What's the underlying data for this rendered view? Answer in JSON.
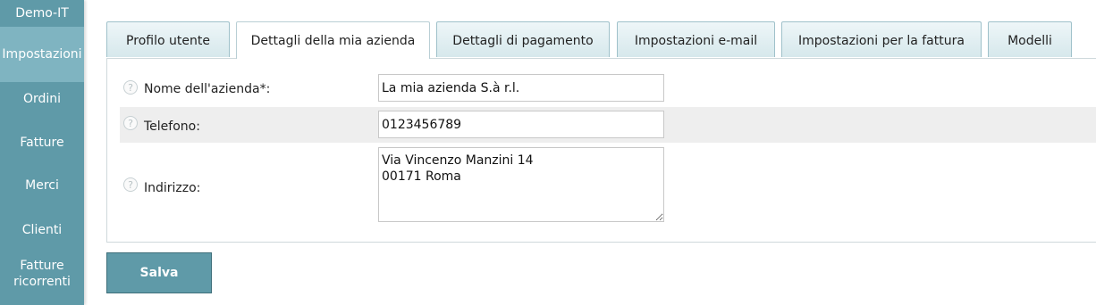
{
  "sidebar": {
    "brand": "Demo-IT",
    "items": [
      {
        "label": "Impostazioni",
        "active": true
      },
      {
        "label": "Ordini"
      },
      {
        "label": "Fatture"
      },
      {
        "label": "Merci"
      },
      {
        "label": "Clienti"
      },
      {
        "label": "Fatture ricorrenti"
      }
    ]
  },
  "tabs": [
    {
      "label": "Profilo utente"
    },
    {
      "label": "Dettagli della mia azienda",
      "active": true
    },
    {
      "label": "Dettagli di pagamento"
    },
    {
      "label": "Impostazioni e-mail"
    },
    {
      "label": "Impostazioni per la fattura"
    },
    {
      "label": "Modelli"
    }
  ],
  "form": {
    "company_name": {
      "label": "Nome dell'azienda*:",
      "value": "La mia azienda S.à r.l."
    },
    "phone": {
      "label": "Telefono:",
      "value": "0123456789"
    },
    "address": {
      "label": "Indirizzo:",
      "value": "Via Vincenzo Manzini 14\n00171 Roma"
    },
    "help_glyph": "?"
  },
  "actions": {
    "save_label": "Salva"
  },
  "colors": {
    "sidebar": "#5f9aa8",
    "sidebar_active": "#7fb4c1",
    "save_button": "#5f9aa8"
  }
}
